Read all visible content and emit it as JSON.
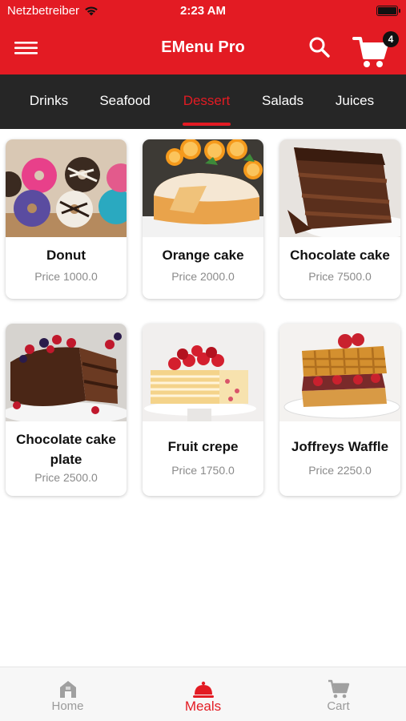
{
  "status_bar": {
    "carrier": "Netzbetreiber",
    "time": "2:23 AM"
  },
  "header": {
    "title": "EMenu Pro",
    "cart_count": "4",
    "brand_color": "#e31b23"
  },
  "tabs": [
    {
      "label": "Drinks",
      "active": false
    },
    {
      "label": "Seafood",
      "active": false
    },
    {
      "label": "Dessert",
      "active": true
    },
    {
      "label": "Salads",
      "active": false
    },
    {
      "label": "Juices",
      "active": false
    }
  ],
  "items": [
    {
      "name": "Donut",
      "price": "Price 1000.0",
      "icon": "donut-image"
    },
    {
      "name": "Orange cake",
      "price": "Price 2000.0",
      "icon": "orange-cake-image"
    },
    {
      "name": "Chocolate cake",
      "price": "Price 7500.0",
      "icon": "chocolate-cake-image"
    },
    {
      "name": "Chocolate cake plate",
      "price": "Price 2500.0",
      "icon": "chocolate-cake-plate-image"
    },
    {
      "name": "Fruit crepe",
      "price": "Price 1750.0",
      "icon": "fruit-crepe-image"
    },
    {
      "name": "Joffreys Waffle",
      "price": "Price 2250.0",
      "icon": "waffle-image"
    }
  ],
  "bottom_nav": [
    {
      "label": "Home",
      "icon": "home-icon",
      "active": false
    },
    {
      "label": "Meals",
      "icon": "cloche-icon",
      "active": true
    },
    {
      "label": "Cart",
      "icon": "cart-icon",
      "active": false
    }
  ]
}
